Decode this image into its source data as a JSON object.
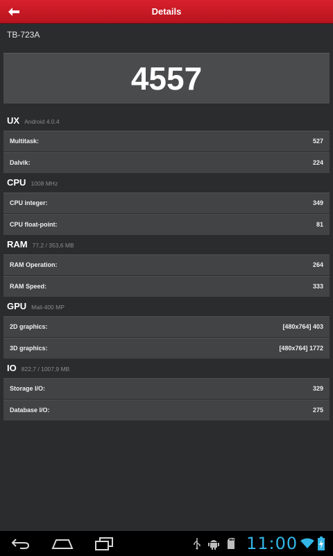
{
  "header": {
    "title": "Details"
  },
  "device": {
    "name": "TB-723A"
  },
  "score": {
    "total": "4557"
  },
  "sections": [
    {
      "name": "UX",
      "subtitle": "Android 4.0.4",
      "rows": [
        {
          "label": "Multitask:",
          "value": "527"
        },
        {
          "label": "Dalvik:",
          "value": "224"
        }
      ]
    },
    {
      "name": "CPU",
      "subtitle": "1008 MHz",
      "rows": [
        {
          "label": "CPU integer:",
          "value": "349"
        },
        {
          "label": "CPU float-point:",
          "value": "81"
        }
      ]
    },
    {
      "name": "RAM",
      "subtitle": "77,2 / 353,6 MB",
      "rows": [
        {
          "label": "RAM Operation:",
          "value": "264"
        },
        {
          "label": "RAM Speed:",
          "value": "333"
        }
      ]
    },
    {
      "name": "GPU",
      "subtitle": "Mali-400 MP",
      "rows": [
        {
          "label": "2D graphics:",
          "value": "[480x764] 403"
        },
        {
          "label": "3D graphics:",
          "value": "[480x764] 1772"
        }
      ]
    },
    {
      "name": "IO",
      "subtitle": "822,7 / 1007,9 MB",
      "rows": [
        {
          "label": "Storage I/O:",
          "value": "329"
        },
        {
          "label": "Database I/O:",
          "value": "275"
        }
      ]
    }
  ],
  "status_bar": {
    "time": "11:00",
    "icons": [
      "usb-icon",
      "android-debug-icon",
      "sd-card-icon",
      "wifi-icon",
      "battery-charging-icon"
    ]
  },
  "nav_buttons": [
    "back-icon",
    "home-icon",
    "recent-apps-icon"
  ],
  "colors": {
    "header": "#c81a24",
    "background": "#2b2c2e",
    "row": "#424345",
    "clock": "#33b5e5"
  }
}
